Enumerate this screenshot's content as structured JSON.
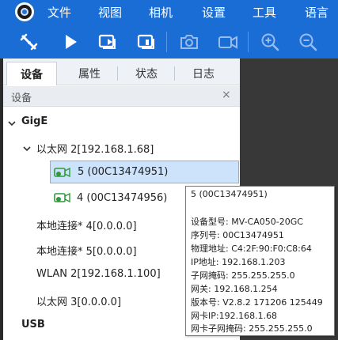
{
  "menu": {
    "items": [
      "文件",
      "视图",
      "相机",
      "设置",
      "工具",
      "语言"
    ]
  },
  "tabs": [
    "设备",
    "属性",
    "状态",
    "日志"
  ],
  "panel": {
    "title": "设备",
    "close": "×"
  },
  "tree": {
    "gige": "GigE",
    "ethernet2": "以太网 2[192.168.1.68]",
    "device1": "5 (00C13474951)",
    "device2": "4 (00C13474956)",
    "local4": "本地连接* 4[0.0.0.0]",
    "local5": "本地连接* 5[0.0.0.0]",
    "wlan2": "WLAN 2[192.168.1.100]",
    "ethernet3": "以太网 3[0.0.0.0]",
    "usb": "USB"
  },
  "tooltip": {
    "title": "5 (00C13474951)",
    "lines": [
      "设备型号:  MV-CA050-20GC",
      "序列号:  00C13474951",
      "物理地址:  C4:2F:90:F0:C8:64",
      "IP地址:  192.168.1.203",
      "子网掩码:  255.255.255.0",
      "网关:  192.168.1.254",
      "版本号:  V2.8.2 171206 125449",
      "网卡IP:192.168.1.68",
      "网卡子网掩码:  255.255.255.0"
    ]
  },
  "colors": {
    "accent": "#1b6dd6",
    "selection": "#cde2fb",
    "online": "#2e9b3a"
  },
  "icons": {
    "toolbar": [
      "disconnect-icon",
      "play-icon",
      "continuous-capture-icon",
      "single-capture-icon",
      "snapshot-icon",
      "record-icon",
      "zoom-in-icon",
      "zoom-out-icon"
    ]
  }
}
